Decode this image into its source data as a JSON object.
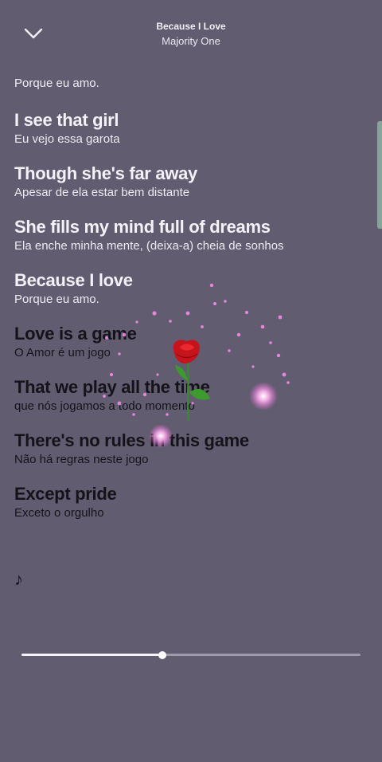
{
  "header": {
    "song_title": "Because I Love",
    "artist": "Majority One",
    "back_icon": "chevron-down-icon"
  },
  "lyrics": {
    "top_line": "Porque eu amo.",
    "stanzas": [
      {
        "main": "I see that girl",
        "sub": "Eu vejo essa garota",
        "state": "past"
      },
      {
        "main": "Though she's far away",
        "sub": "Apesar de ela estar bem distante",
        "state": "past"
      },
      {
        "main": "She fills my mind full of dreams",
        "sub": "Ela enche minha mente, (deixa-a) cheia de sonhos",
        "state": "past"
      },
      {
        "main": "Because I love",
        "sub": "Porque eu amo.",
        "state": "past"
      },
      {
        "main": "Love is a game",
        "sub": "O Amor é um jogo",
        "state": "future"
      },
      {
        "main": "That we play all the time",
        "sub": "que nós jogamos a todo momento",
        "state": "future"
      },
      {
        "main": "There's no rules in this game",
        "sub": "Não há regras neste jogo",
        "state": "future"
      },
      {
        "main": "Except pride",
        "sub": "Exceto o orgulho",
        "state": "future"
      }
    ],
    "note_symbol": "♪"
  },
  "player": {
    "progress_fraction": 0.415
  },
  "overlay": {
    "decoration": "rose-with-sparkles",
    "rose_icon": "rose-icon"
  },
  "colors": {
    "background": "#625c71",
    "active_text": "#f4f2f8",
    "upcoming_text": "#15131a"
  }
}
